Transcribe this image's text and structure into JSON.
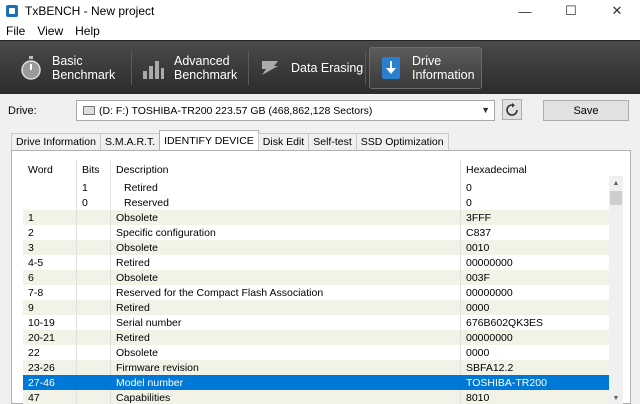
{
  "window": {
    "title": "TxBENCH - New project"
  },
  "menu": [
    {
      "label": "File",
      "key": "F"
    },
    {
      "label": "View",
      "key": "V"
    },
    {
      "label": "Help",
      "key": "H"
    }
  ],
  "toolbar": {
    "basic": "Basic\nBenchmark",
    "advanced": "Advanced\nBenchmark",
    "erasing": "Data Erasing",
    "driveinfo": "Drive\nInformation"
  },
  "drive": {
    "label": "Drive:",
    "selected": "(D: F:) TOSHIBA-TR200  223.57 GB (468,862,128 Sectors)",
    "save_label": "Save"
  },
  "tabs": [
    "Drive Information",
    "S.M.A.R.T.",
    "IDENTIFY DEVICE",
    "Disk Edit",
    "Self-test",
    "SSD Optimization"
  ],
  "active_tab": "IDENTIFY DEVICE",
  "columns": {
    "word": "Word",
    "bits": "Bits",
    "desc": "Description",
    "hex": "Hexadecimal"
  },
  "rows": [
    {
      "word": "",
      "bits": "1",
      "desc": "Retired",
      "hex": "0",
      "sub": true
    },
    {
      "word": "",
      "bits": "0",
      "desc": "Reserved",
      "hex": "0",
      "sub": true
    },
    {
      "word": "1",
      "bits": "",
      "desc": "Obsolete",
      "hex": "3FFF",
      "shade": true
    },
    {
      "word": "2",
      "bits": "",
      "desc": "Specific configuration",
      "hex": "C837"
    },
    {
      "word": "3",
      "bits": "",
      "desc": "Obsolete",
      "hex": "0010",
      "shade": true
    },
    {
      "word": "4-5",
      "bits": "",
      "desc": "Retired",
      "hex": "00000000"
    },
    {
      "word": "6",
      "bits": "",
      "desc": "Obsolete",
      "hex": "003F",
      "shade": true
    },
    {
      "word": "7-8",
      "bits": "",
      "desc": "Reserved for the Compact Flash Association",
      "hex": "00000000"
    },
    {
      "word": "9",
      "bits": "",
      "desc": "Retired",
      "hex": "0000",
      "shade": true
    },
    {
      "word": "10-19",
      "bits": "",
      "desc": "Serial number",
      "hex": "676B602QK3ES"
    },
    {
      "word": "20-21",
      "bits": "",
      "desc": "Retired",
      "hex": "00000000",
      "shade": true
    },
    {
      "word": "22",
      "bits": "",
      "desc": "Obsolete",
      "hex": "0000"
    },
    {
      "word": "23-26",
      "bits": "",
      "desc": "Firmware revision",
      "hex": "SBFA12.2",
      "shade": true
    },
    {
      "word": "27-46",
      "bits": "",
      "desc": "Model number",
      "hex": "TOSHIBA-TR200",
      "selected": true
    },
    {
      "word": "47",
      "bits": "",
      "desc": "Capabilities",
      "hex": "8010",
      "shade": true
    }
  ],
  "colors": {
    "toolbar_bg": "#2c2c2c",
    "selection": "#0078d7",
    "row_shade": "#f2f2e6"
  }
}
